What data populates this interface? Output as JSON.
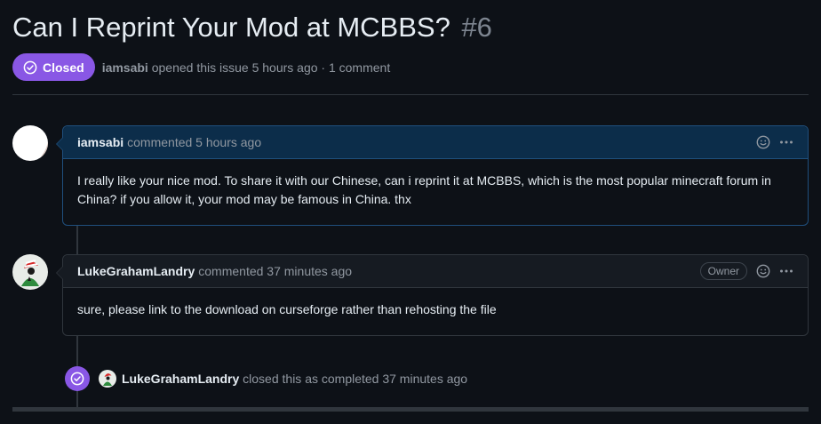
{
  "issue": {
    "title": "Can I Reprint Your Mod at MCBBS?",
    "number": "#6",
    "state": "Closed",
    "author": "iamsabi",
    "opened_text": "opened this issue 5 hours ago · 1 comment"
  },
  "comments": [
    {
      "author": "iamsabi",
      "action": "commented 5 hours ago",
      "body": "I really like your nice mod. To share it with our Chinese, can i reprint it at MCBBS, which is the most popular minecraft forum in China? if you allow it, your mod may be famous in China. thx"
    },
    {
      "author": "LukeGrahamLandry",
      "action": "commented 37 minutes ago",
      "role": "Owner",
      "body": "sure, please link to the download on curseforge rather than rehosting the file"
    }
  ],
  "event": {
    "actor": "LukeGrahamLandry",
    "text": "closed this as completed 37 minutes ago"
  },
  "colors": {
    "closed_purple": "#8957e5",
    "background": "#0d1117",
    "border": "#30363d",
    "author_header": "#0c2d4a"
  },
  "icons": [
    "check-circle-icon",
    "smiley-icon",
    "kebab-menu-icon",
    "avatar-image"
  ]
}
